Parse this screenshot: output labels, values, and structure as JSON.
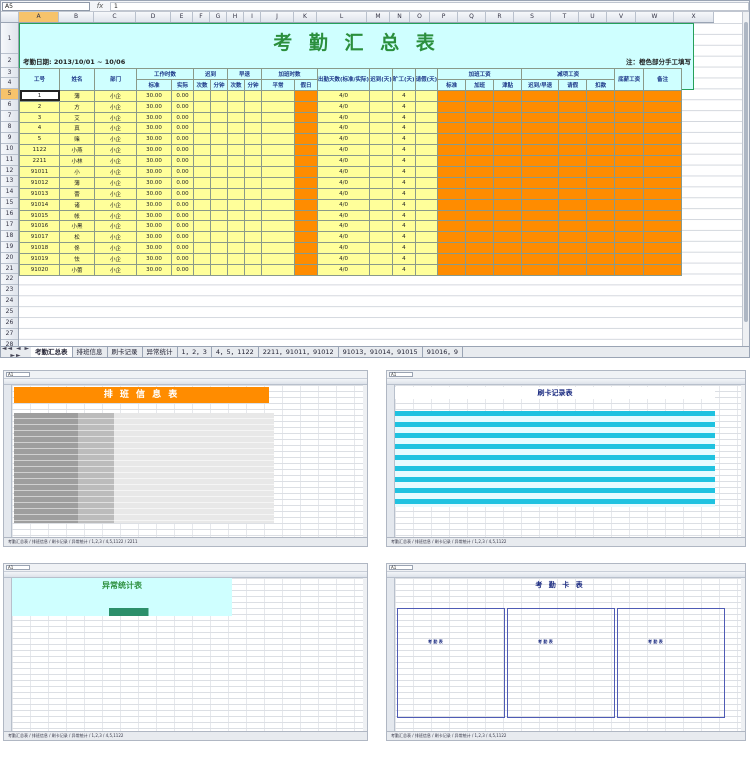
{
  "main": {
    "name_box": "A5",
    "fx": "fx",
    "formula_value": "1",
    "columns": [
      "A",
      "B",
      "C",
      "D",
      "E",
      "F",
      "G",
      "H",
      "I",
      "J",
      "K",
      "L",
      "M",
      "N",
      "O",
      "P",
      "Q",
      "R",
      "S",
      "T",
      "U",
      "V",
      "W",
      "X"
    ],
    "rows": [
      "1",
      "2",
      "3",
      "4",
      "5",
      "6",
      "7",
      "8",
      "9",
      "10",
      "11",
      "12",
      "13",
      "14",
      "15",
      "16",
      "17",
      "18",
      "19",
      "20",
      "21",
      "22",
      "23",
      "24",
      "25",
      "26",
      "27",
      "28"
    ],
    "title": "考 勤 汇 总 表",
    "period": "考勤日期: 2013/10/01 ~ 10/06",
    "note": "注：橙色部分手工填写",
    "headers": {
      "emp_id": "工号",
      "name": "姓名",
      "dept": "部门",
      "work_hours": "工作时数",
      "standard": "标准",
      "actual": "实际",
      "late": "迟到",
      "early": "早退",
      "overtime_hours": "加班时数",
      "times": "次数",
      "minutes": "分钟",
      "ordinary": "平常",
      "holiday": "假日",
      "attend_days": "出勤天数(标准/实际)",
      "absent": "迟到(天)",
      "absent_days": "旷工(天)",
      "leave_days": "请假(天)",
      "ot_pay": "加班工资",
      "ot_std": "标准",
      "ot_add": "加班",
      "ot_sub": "津贴",
      "deduct": "减项工资",
      "deduct_late": "迟到/早退",
      "deduct_leave": "请假",
      "deduct_other": "扣款",
      "base_pay": "底薪工资",
      "remark": "备注"
    },
    "employees": [
      {
        "id": "1",
        "name": "薄",
        "dept": "小企",
        "std": "30.00",
        "act": "0.00",
        "days": "4/0",
        "abs": "4"
      },
      {
        "id": "2",
        "name": "方",
        "dept": "小企",
        "std": "30.00",
        "act": "0.00",
        "days": "4/0",
        "abs": "4"
      },
      {
        "id": "3",
        "name": "艾",
        "dept": "小企",
        "std": "30.00",
        "act": "0.00",
        "days": "4/0",
        "abs": "4"
      },
      {
        "id": "4",
        "name": "真",
        "dept": "小企",
        "std": "30.00",
        "act": "0.00",
        "days": "4/0",
        "abs": "4"
      },
      {
        "id": "5",
        "name": "赌",
        "dept": "小企",
        "std": "30.00",
        "act": "0.00",
        "days": "4/0",
        "abs": "4"
      },
      {
        "id": "1122",
        "name": "小燕",
        "dept": "小企",
        "std": "30.00",
        "act": "0.00",
        "days": "4/0",
        "abs": "4"
      },
      {
        "id": "2211",
        "name": "小林",
        "dept": "小企",
        "std": "30.00",
        "act": "0.00",
        "days": "4/0",
        "abs": "4"
      },
      {
        "id": "91011",
        "name": "小",
        "dept": "小企",
        "std": "30.00",
        "act": "0.00",
        "days": "4/0",
        "abs": "4"
      },
      {
        "id": "91012",
        "name": "薄",
        "dept": "小企",
        "std": "30.00",
        "act": "0.00",
        "days": "4/0",
        "abs": "4"
      },
      {
        "id": "91013",
        "name": "蕾",
        "dept": "小企",
        "std": "30.00",
        "act": "0.00",
        "days": "4/0",
        "abs": "4"
      },
      {
        "id": "91014",
        "name": "诸",
        "dept": "小企",
        "std": "30.00",
        "act": "0.00",
        "days": "4/0",
        "abs": "4"
      },
      {
        "id": "91015",
        "name": "帐",
        "dept": "小企",
        "std": "30.00",
        "act": "0.00",
        "days": "4/0",
        "abs": "4"
      },
      {
        "id": "91016",
        "name": "小黑",
        "dept": "小企",
        "std": "30.00",
        "act": "0.00",
        "days": "4/0",
        "abs": "4"
      },
      {
        "id": "91017",
        "name": "松",
        "dept": "小企",
        "std": "30.00",
        "act": "0.00",
        "days": "4/0",
        "abs": "4"
      },
      {
        "id": "91018",
        "name": "佟",
        "dept": "小企",
        "std": "30.00",
        "act": "0.00",
        "days": "4/0",
        "abs": "4"
      },
      {
        "id": "91019",
        "name": "怯",
        "dept": "小企",
        "std": "30.00",
        "act": "0.00",
        "days": "4/0",
        "abs": "4"
      },
      {
        "id": "91020",
        "name": "小蕾",
        "dept": "小企",
        "std": "30.00",
        "act": "0.00",
        "days": "4/0",
        "abs": "4"
      }
    ],
    "tabs": [
      "考勤汇总表",
      "排班信息",
      "刷卡记录",
      "异常统计",
      "1，2，3",
      "4，5，1122",
      "2211，91011，91012",
      "91013，91014，91015",
      "91016，9"
    ],
    "tab_nav": "◄◄ ◄ ► ►►"
  },
  "thumbs": {
    "schedule": {
      "title": "排 班 信 息 表",
      "name_box": "A1",
      "tabs": "考勤汇总表 / 排班信息 / 刷卡记录 / 异常统计 / 1,2,3 / 4,5,1122 / 2211"
    },
    "swipe": {
      "title": "刷卡记录表",
      "name_box": "A1",
      "tabs": "考勤汇总表 / 排班信息 / 刷卡记录 / 异常统计 / 1,2,3 / 4,5,1122"
    },
    "anomaly": {
      "title": "异常统计表",
      "name_box": "A1",
      "tabs": "考勤汇总表 / 排班信息 / 刷卡记录 / 异常统计 / 1,2,3 / 4,5,1122"
    },
    "card": {
      "title": "考 勤 卡 表",
      "name_box": "A1",
      "section": "考 勤 表",
      "tabs": "考勤汇总表 / 排班信息 / 刷卡记录 / 异常统计 / 1,2,3 / 4,5,1122"
    }
  },
  "colors": {
    "title_bg": "#cfffff",
    "title_text": "#2b8f3d",
    "manual_fill": "#ff8c00",
    "data_fill": "#ffff9a",
    "swipe_band": "#1fc2e0"
  }
}
